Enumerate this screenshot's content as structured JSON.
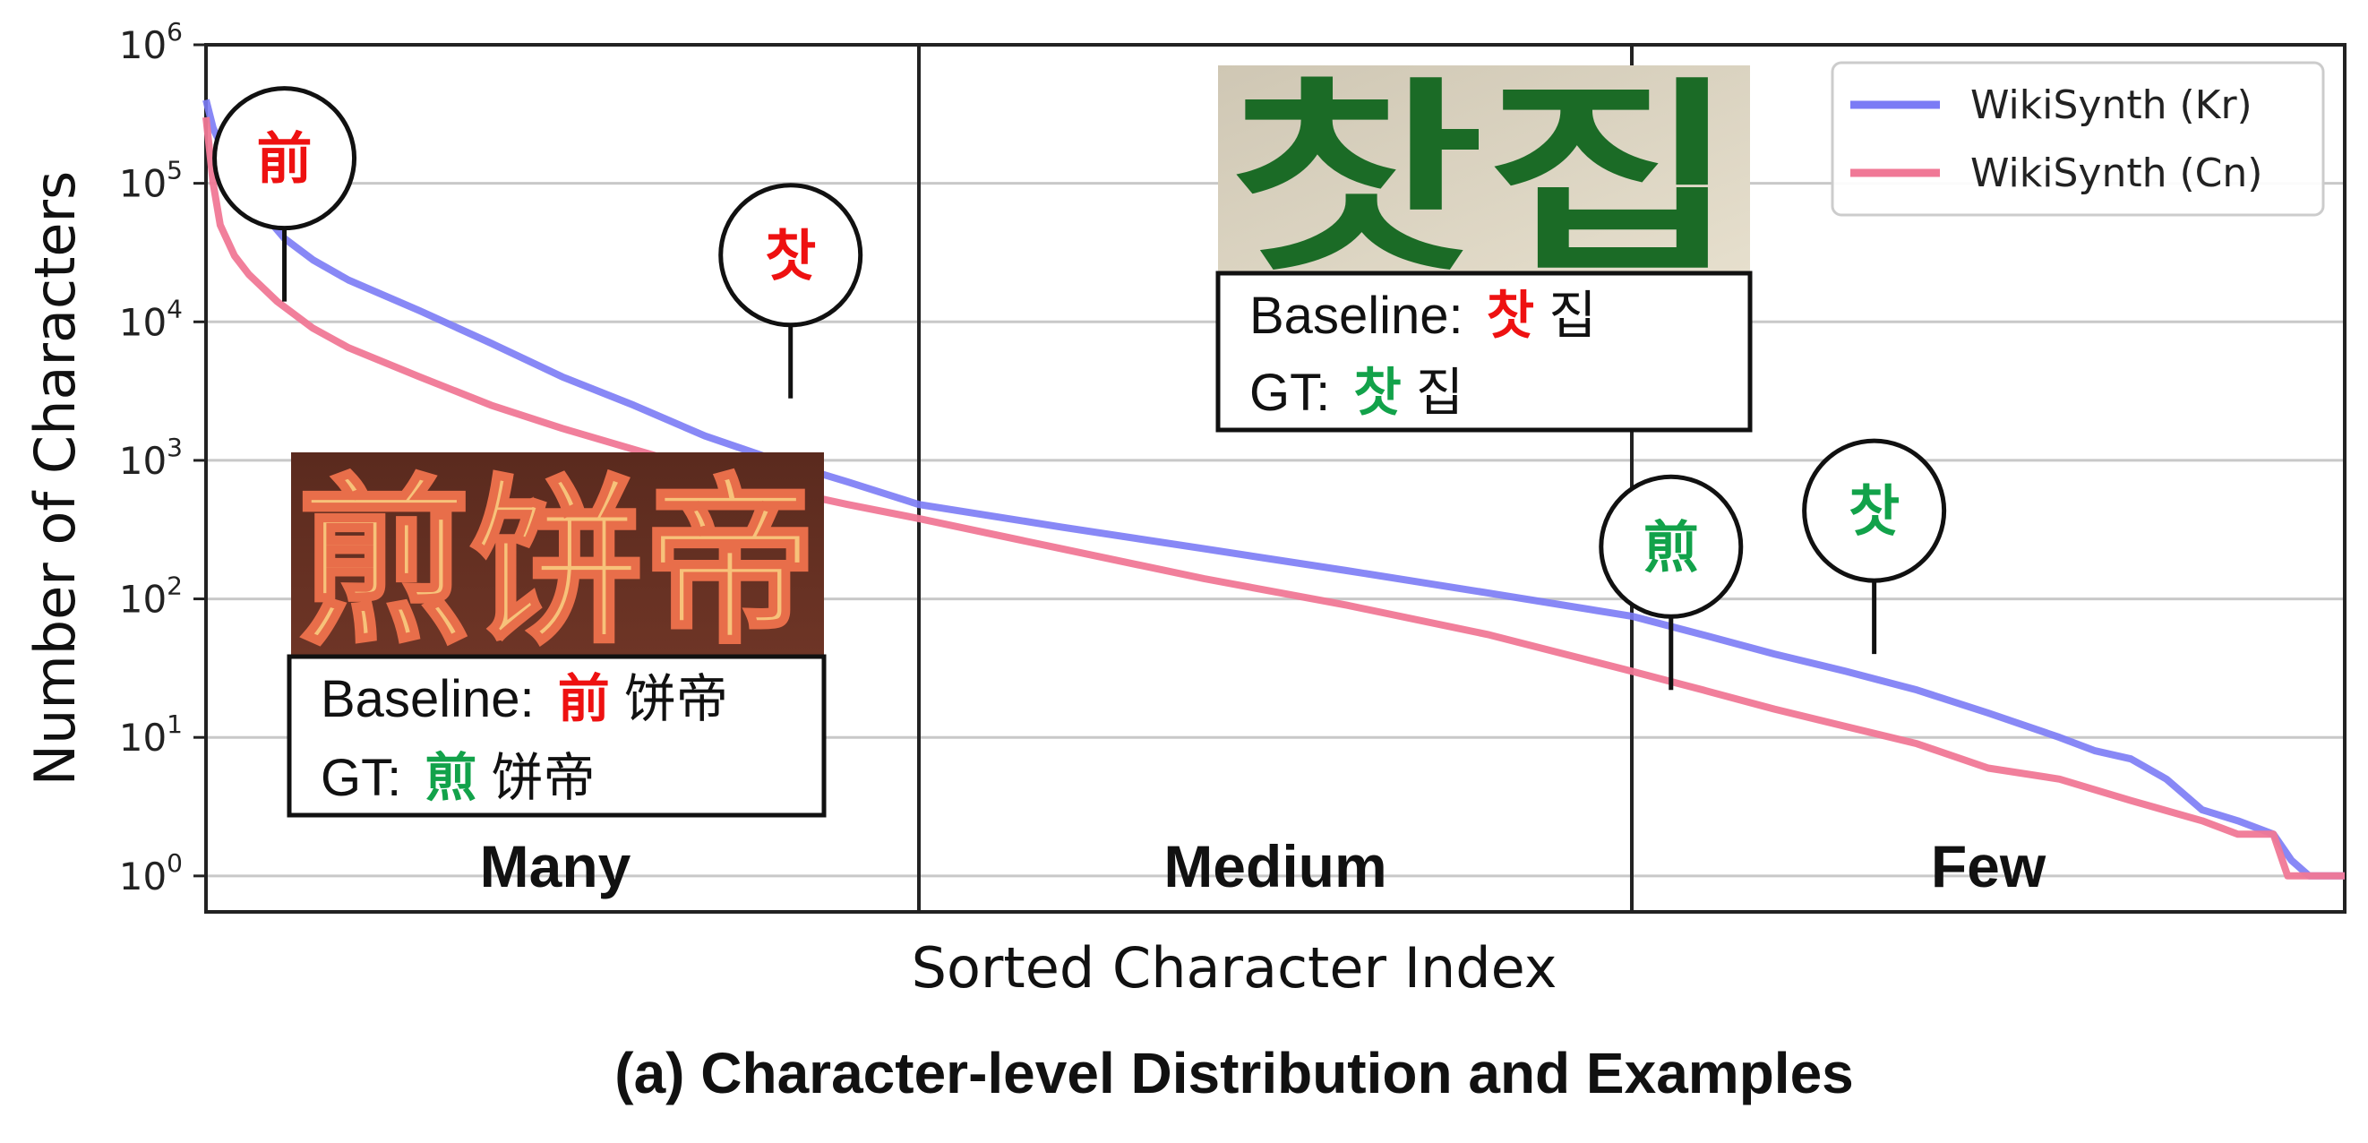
{
  "chart_data": {
    "type": "line",
    "title": "",
    "caption": "(a) Character-level Distribution and Examples",
    "xlabel": "Sorted Character Index",
    "ylabel": "Number of Characters",
    "yscale": "log",
    "ylim": [
      0.55,
      1000000
    ],
    "xlim": [
      0,
      3000
    ],
    "y_tick_labels": [
      {
        "base": "10",
        "exp": "0",
        "value": 1
      },
      {
        "base": "10",
        "exp": "1",
        "value": 10
      },
      {
        "base": "10",
        "exp": "2",
        "value": 100
      },
      {
        "base": "10",
        "exp": "3",
        "value": 1000
      },
      {
        "base": "10",
        "exp": "4",
        "value": 10000
      },
      {
        "base": "10",
        "exp": "5",
        "value": 100000
      },
      {
        "base": "10",
        "exp": "6",
        "value": 1000000
      }
    ],
    "grid": "horizontal",
    "legend_position": "top-right",
    "vertical_lines_x": [
      1000,
      2000
    ],
    "regions": [
      {
        "label": "Many",
        "x_center": 490
      },
      {
        "label": "Medium",
        "x_center": 1500
      },
      {
        "label": "Few",
        "x_center": 2500
      }
    ],
    "series": [
      {
        "name": "WikiSynth (Kr)",
        "color": "#7b7bf5",
        "x": [
          0,
          10,
          30,
          60,
          110,
          150,
          200,
          300,
          400,
          500,
          600,
          700,
          800,
          900,
          1000,
          1200,
          1400,
          1600,
          1800,
          2000,
          2100,
          2200,
          2300,
          2400,
          2500,
          2600,
          2650,
          2700,
          2750,
          2800,
          2850,
          2900,
          2925,
          2950,
          2970,
          3000
        ],
        "y": [
          400000,
          250000,
          150000,
          80000,
          40000,
          28000,
          20000,
          12000,
          7000,
          4000,
          2500,
          1500,
          1000,
          700,
          480,
          330,
          230,
          160,
          110,
          75,
          55,
          40,
          30,
          22,
          15,
          10,
          8,
          7,
          5,
          3,
          2.5,
          2,
          1.3,
          1,
          1,
          1
        ]
      },
      {
        "name": "WikiSynth (Cn)",
        "color": "#f07896",
        "x": [
          0,
          10,
          20,
          40,
          60,
          100,
          150,
          200,
          300,
          400,
          500,
          600,
          700,
          800,
          900,
          1000,
          1200,
          1400,
          1600,
          1800,
          2000,
          2100,
          2200,
          2300,
          2400,
          2500,
          2600,
          2700,
          2800,
          2850,
          2900,
          2920,
          2950,
          3000
        ],
        "y": [
          300000,
          100000,
          50000,
          30000,
          22000,
          14000,
          9000,
          6500,
          4000,
          2500,
          1700,
          1200,
          850,
          620,
          480,
          380,
          230,
          140,
          90,
          55,
          30,
          22,
          16,
          12,
          9,
          6,
          5,
          3.5,
          2.5,
          2,
          2,
          1,
          1,
          1
        ]
      }
    ],
    "annotations": [
      {
        "id": "cn-wrong",
        "char": "前",
        "color": "#ee1111",
        "x": 110,
        "y": 14000
      },
      {
        "id": "kr-wrong",
        "char": "찻",
        "color": "#ee1111",
        "x": 820,
        "y": 2800
      },
      {
        "id": "cn-gt",
        "char": "煎",
        "color": "#12a24a",
        "x": 2055,
        "y": 22
      },
      {
        "id": "kr-gt",
        "char": "찻",
        "color": "#12a24a",
        "x": 2340,
        "y": 40
      }
    ],
    "examples": [
      {
        "id": "cn",
        "image_text": "煎饼帝",
        "baseline_label": "Baseline:",
        "baseline_wrong": "前",
        "baseline_rest": "饼帝",
        "gt_label": "GT:",
        "gt_correct": "煎",
        "gt_rest": "饼帝"
      },
      {
        "id": "kr",
        "image_text": "찻집",
        "baseline_label": "Baseline:",
        "baseline_wrong": "찻",
        "baseline_rest": "집",
        "gt_label": "GT:",
        "gt_correct": "찻",
        "gt_rest": "집"
      }
    ],
    "colors": {
      "wrong": "#ee1111",
      "correct": "#12a24a"
    }
  }
}
